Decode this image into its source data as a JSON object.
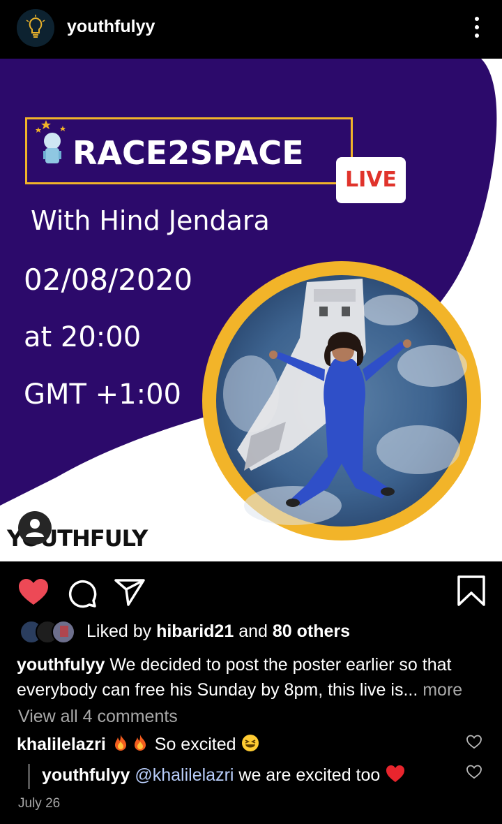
{
  "header": {
    "username": "youthfulyy"
  },
  "poster": {
    "title": "RACE2SPACE",
    "badge": "LIVE",
    "host": "With Hind Jendara",
    "date": "02/08/2020",
    "time": "at 20:00",
    "timezone": "GMT +1:00",
    "brand": "YOUTHFULY",
    "colors": {
      "purple": "#2c0a6b",
      "gold": "#f2b429",
      "live_red": "#e0332b"
    }
  },
  "actions": {
    "like_icon": "heart-filled-icon",
    "comment_icon": "comment-icon",
    "share_icon": "send-icon",
    "save_icon": "bookmark-icon",
    "like_color": "#ed4956"
  },
  "likes": {
    "prefix": "Liked by",
    "user": "hibarid21",
    "joiner": "and",
    "others": "80 others"
  },
  "caption": {
    "username": "youthfulyy",
    "text": "We decided to post the poster earlier so that everybody can free his Sunday by 8pm, this live is...",
    "more": "more"
  },
  "comments": {
    "view_all": "View all 4 comments",
    "first": {
      "username": "khalilelazri",
      "text": "So excited"
    },
    "reply": {
      "username": "youthfulyy",
      "mention": "@khalilelazri",
      "text": "we are excited too"
    }
  },
  "timestamp": "July 26"
}
